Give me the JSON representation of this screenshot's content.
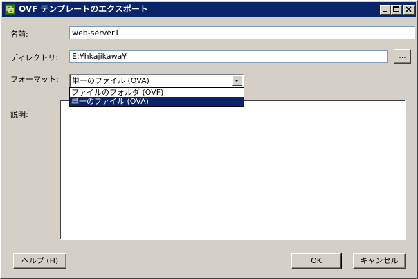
{
  "window": {
    "title": "OVF テンプレートのエクスポート",
    "minimize_icon": "minimize-icon",
    "maximize_icon": "maximize-icon",
    "close_icon": "close-icon"
  },
  "form": {
    "name_label": "名前:",
    "name_value": "web-server1",
    "directory_label": "ディレクトリ:",
    "directory_value": "E:¥hkajikawa¥",
    "browse_label": "...",
    "format_label": "フォーマット:",
    "format_selected": "単一のファイル (OVA)",
    "format_options": [
      "ファイルのフォルダ (OVF)",
      "単一のファイル (OVA)"
    ],
    "description_label": "説明:",
    "description_value": ""
  },
  "buttons": {
    "help": "ヘルプ (H)",
    "ok": "OK",
    "cancel": "キャンセル"
  },
  "colors": {
    "titlebar": "#0a246a",
    "window_bg": "#d4d0c8",
    "selection": "#0a246a"
  }
}
